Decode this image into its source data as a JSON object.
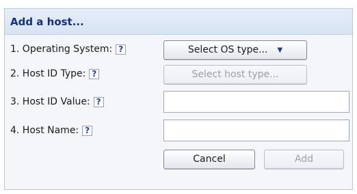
{
  "dialog": {
    "title": "Add a host..."
  },
  "fields": {
    "os": {
      "label": "1. Operating System:",
      "help": "?",
      "select_label": "Select OS type...",
      "caret": "▼"
    },
    "host_id_type": {
      "label": "2. Host ID Type:",
      "help": "?",
      "select_label": "Select host type...",
      "disabled": true
    },
    "host_id_value": {
      "label": "3. Host ID Value:",
      "help": "?",
      "value": ""
    },
    "host_name": {
      "label": "4. Host Name:",
      "help": "?",
      "value": ""
    }
  },
  "actions": {
    "cancel_label": "Cancel",
    "add_label": "Add",
    "add_disabled": true
  },
  "colors": {
    "title": "#15317e",
    "header_bg": "#dce6f4",
    "panel_bg": "#f4f6f9",
    "help_icon": "#1f3fbf"
  },
  "icons": {
    "help": "question-mark-box",
    "dropdown": "triangle-down"
  }
}
